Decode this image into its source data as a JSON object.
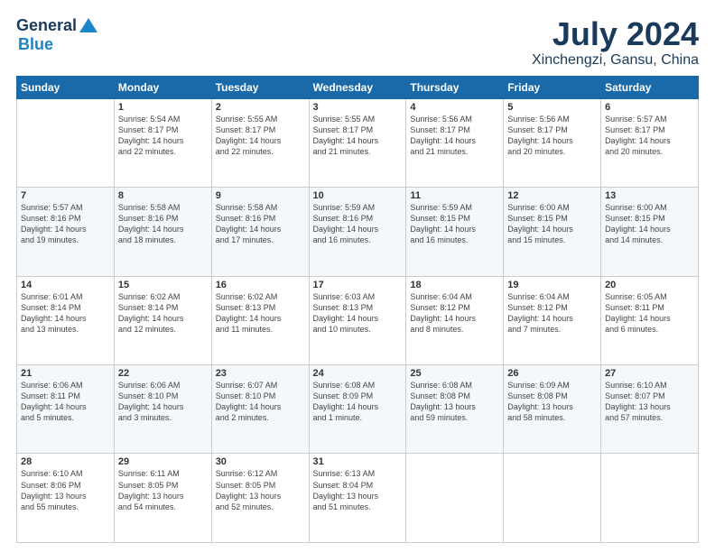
{
  "header": {
    "logo_general": "General",
    "logo_blue": "Blue",
    "title": "July 2024",
    "location": "Xinchengzi, Gansu, China"
  },
  "days_of_week": [
    "Sunday",
    "Monday",
    "Tuesday",
    "Wednesday",
    "Thursday",
    "Friday",
    "Saturday"
  ],
  "weeks": [
    [
      {
        "day": "",
        "info": ""
      },
      {
        "day": "1",
        "info": "Sunrise: 5:54 AM\nSunset: 8:17 PM\nDaylight: 14 hours\nand 22 minutes."
      },
      {
        "day": "2",
        "info": "Sunrise: 5:55 AM\nSunset: 8:17 PM\nDaylight: 14 hours\nand 22 minutes."
      },
      {
        "day": "3",
        "info": "Sunrise: 5:55 AM\nSunset: 8:17 PM\nDaylight: 14 hours\nand 21 minutes."
      },
      {
        "day": "4",
        "info": "Sunrise: 5:56 AM\nSunset: 8:17 PM\nDaylight: 14 hours\nand 21 minutes."
      },
      {
        "day": "5",
        "info": "Sunrise: 5:56 AM\nSunset: 8:17 PM\nDaylight: 14 hours\nand 20 minutes."
      },
      {
        "day": "6",
        "info": "Sunrise: 5:57 AM\nSunset: 8:17 PM\nDaylight: 14 hours\nand 20 minutes."
      }
    ],
    [
      {
        "day": "7",
        "info": "Sunrise: 5:57 AM\nSunset: 8:16 PM\nDaylight: 14 hours\nand 19 minutes."
      },
      {
        "day": "8",
        "info": "Sunrise: 5:58 AM\nSunset: 8:16 PM\nDaylight: 14 hours\nand 18 minutes."
      },
      {
        "day": "9",
        "info": "Sunrise: 5:58 AM\nSunset: 8:16 PM\nDaylight: 14 hours\nand 17 minutes."
      },
      {
        "day": "10",
        "info": "Sunrise: 5:59 AM\nSunset: 8:16 PM\nDaylight: 14 hours\nand 16 minutes."
      },
      {
        "day": "11",
        "info": "Sunrise: 5:59 AM\nSunset: 8:15 PM\nDaylight: 14 hours\nand 16 minutes."
      },
      {
        "day": "12",
        "info": "Sunrise: 6:00 AM\nSunset: 8:15 PM\nDaylight: 14 hours\nand 15 minutes."
      },
      {
        "day": "13",
        "info": "Sunrise: 6:00 AM\nSunset: 8:15 PM\nDaylight: 14 hours\nand 14 minutes."
      }
    ],
    [
      {
        "day": "14",
        "info": "Sunrise: 6:01 AM\nSunset: 8:14 PM\nDaylight: 14 hours\nand 13 minutes."
      },
      {
        "day": "15",
        "info": "Sunrise: 6:02 AM\nSunset: 8:14 PM\nDaylight: 14 hours\nand 12 minutes."
      },
      {
        "day": "16",
        "info": "Sunrise: 6:02 AM\nSunset: 8:13 PM\nDaylight: 14 hours\nand 11 minutes."
      },
      {
        "day": "17",
        "info": "Sunrise: 6:03 AM\nSunset: 8:13 PM\nDaylight: 14 hours\nand 10 minutes."
      },
      {
        "day": "18",
        "info": "Sunrise: 6:04 AM\nSunset: 8:12 PM\nDaylight: 14 hours\nand 8 minutes."
      },
      {
        "day": "19",
        "info": "Sunrise: 6:04 AM\nSunset: 8:12 PM\nDaylight: 14 hours\nand 7 minutes."
      },
      {
        "day": "20",
        "info": "Sunrise: 6:05 AM\nSunset: 8:11 PM\nDaylight: 14 hours\nand 6 minutes."
      }
    ],
    [
      {
        "day": "21",
        "info": "Sunrise: 6:06 AM\nSunset: 8:11 PM\nDaylight: 14 hours\nand 5 minutes."
      },
      {
        "day": "22",
        "info": "Sunrise: 6:06 AM\nSunset: 8:10 PM\nDaylight: 14 hours\nand 3 minutes."
      },
      {
        "day": "23",
        "info": "Sunrise: 6:07 AM\nSunset: 8:10 PM\nDaylight: 14 hours\nand 2 minutes."
      },
      {
        "day": "24",
        "info": "Sunrise: 6:08 AM\nSunset: 8:09 PM\nDaylight: 14 hours\nand 1 minute."
      },
      {
        "day": "25",
        "info": "Sunrise: 6:08 AM\nSunset: 8:08 PM\nDaylight: 13 hours\nand 59 minutes."
      },
      {
        "day": "26",
        "info": "Sunrise: 6:09 AM\nSunset: 8:08 PM\nDaylight: 13 hours\nand 58 minutes."
      },
      {
        "day": "27",
        "info": "Sunrise: 6:10 AM\nSunset: 8:07 PM\nDaylight: 13 hours\nand 57 minutes."
      }
    ],
    [
      {
        "day": "28",
        "info": "Sunrise: 6:10 AM\nSunset: 8:06 PM\nDaylight: 13 hours\nand 55 minutes."
      },
      {
        "day": "29",
        "info": "Sunrise: 6:11 AM\nSunset: 8:05 PM\nDaylight: 13 hours\nand 54 minutes."
      },
      {
        "day": "30",
        "info": "Sunrise: 6:12 AM\nSunset: 8:05 PM\nDaylight: 13 hours\nand 52 minutes."
      },
      {
        "day": "31",
        "info": "Sunrise: 6:13 AM\nSunset: 8:04 PM\nDaylight: 13 hours\nand 51 minutes."
      },
      {
        "day": "",
        "info": ""
      },
      {
        "day": "",
        "info": ""
      },
      {
        "day": "",
        "info": ""
      }
    ]
  ]
}
